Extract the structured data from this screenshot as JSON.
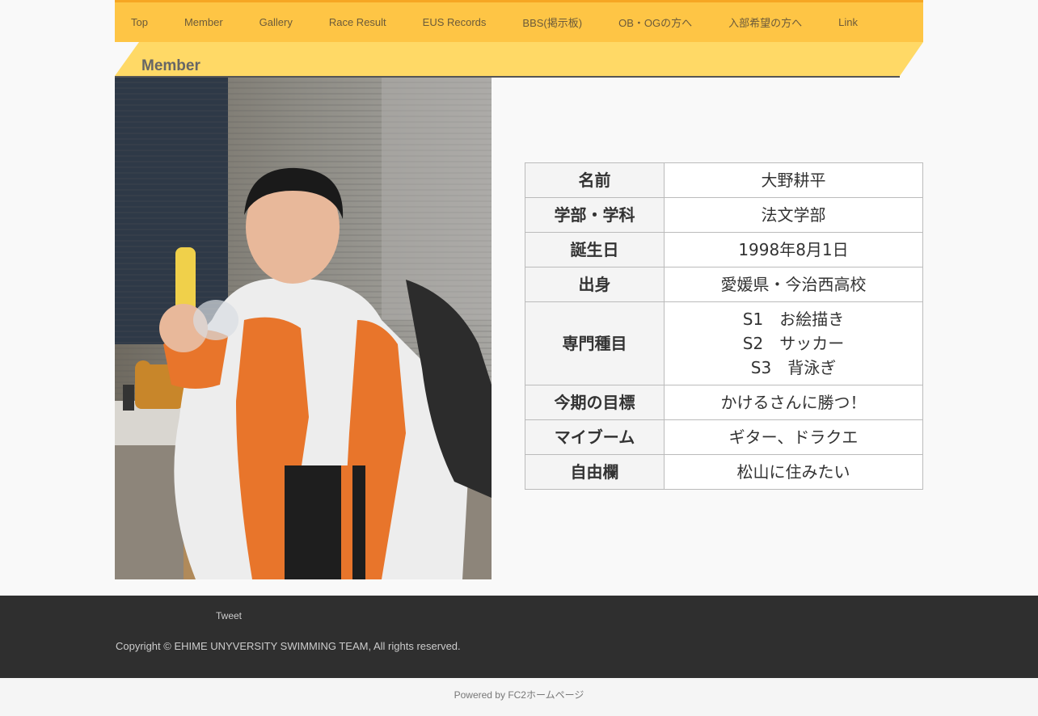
{
  "nav": {
    "items": [
      {
        "label": "Top"
      },
      {
        "label": "Member"
      },
      {
        "label": "Gallery"
      },
      {
        "label": "Race Result"
      },
      {
        "label": "EUS Records"
      },
      {
        "label": "BBS(掲示板)"
      },
      {
        "label": "OB・OGの方へ"
      },
      {
        "label": "入部希望の方へ"
      },
      {
        "label": "Link"
      }
    ]
  },
  "page_title": "Member",
  "profile": {
    "rows": [
      {
        "key": "名前",
        "value": "大野耕平"
      },
      {
        "key": "学部・学科",
        "value": "法文学部"
      },
      {
        "key": "誕生日",
        "value": "1998年8月1日"
      },
      {
        "key": "出身",
        "value": "愛媛県・今治西高校"
      },
      {
        "key": "専門種目",
        "lines": [
          "S1　お絵描き",
          "S2　サッカー",
          "S3　背泳ぎ"
        ]
      },
      {
        "key": "今期の目標",
        "value": "かけるさんに勝つ！"
      },
      {
        "key": "マイブーム",
        "value": "ギター、ドラクエ"
      },
      {
        "key": "自由欄",
        "value": "松山に住みたい"
      }
    ]
  },
  "footer": {
    "tweet": "Tweet",
    "copyright": "Copyright © EHIME UNYVERSITY SWIMMING TEAM, All rights reserved."
  },
  "powered": {
    "prefix": "Powered by ",
    "link": "FC2ホームページ"
  },
  "colors": {
    "nav_bg": "#fec545",
    "nav_top": "#f6a623",
    "title_band": "#ffd966",
    "footer_bg": "#2f2f2f"
  }
}
